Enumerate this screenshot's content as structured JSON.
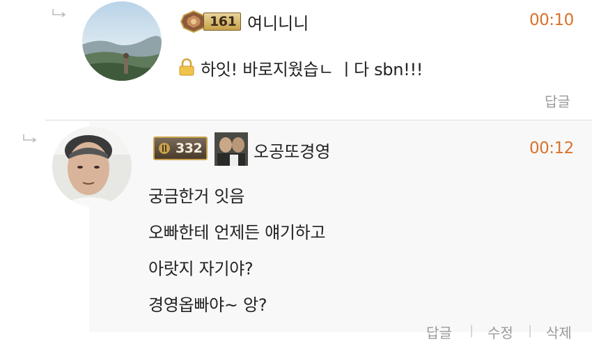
{
  "comments": [
    {
      "level": "161",
      "nickname": "여니니니",
      "time": "00:10",
      "message": "하잇! 바로지웠습ㄴ ㅣ다 sbn!!!",
      "locked": true,
      "actions": [
        "답글"
      ]
    },
    {
      "level": "332",
      "nickname": "오공또경영",
      "time": "00:12",
      "message_lines": [
        "궁금한거 잇음",
        "오빠한테 언제든 얘기하고",
        "아랏지 자기야?",
        "경영옵빠야~ 앙?"
      ],
      "actions": [
        "답글",
        "수정",
        "삭제"
      ]
    }
  ],
  "colors": {
    "time": "#d9722a",
    "badge_gold": "#c9a24a",
    "badge_dark": "#5a4a3a"
  }
}
